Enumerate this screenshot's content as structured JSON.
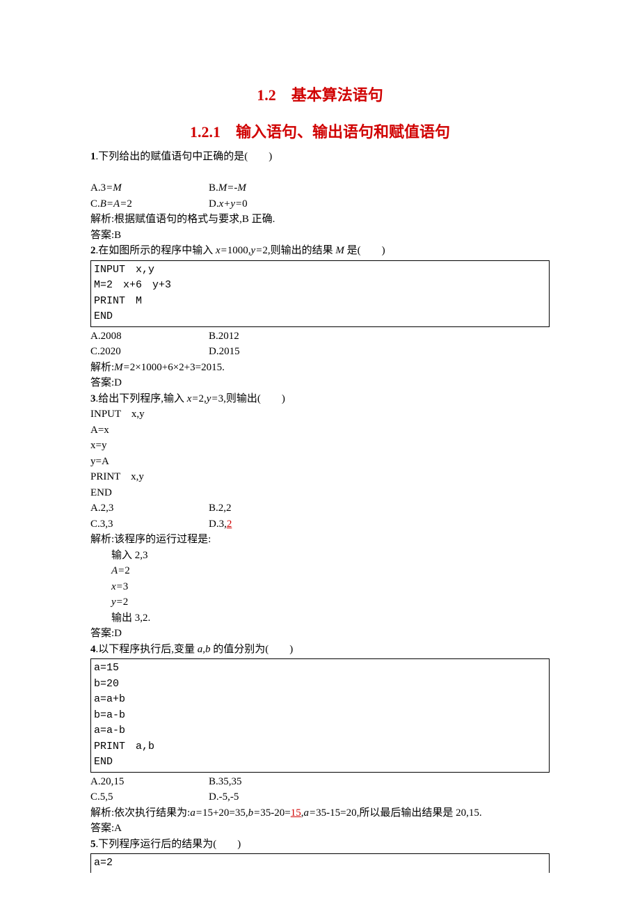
{
  "title_main": "1.2　基本算法语句",
  "title_sub": "1.2.1　输入语句、输出语句和赋值语句",
  "q1": {
    "stem_pre": "1",
    "stem": ".下列给出的赋值语句中正确的是(　　)",
    "a": "A.3=M",
    "b_full": "B.M=-M",
    "c_full": "C.B=A=2",
    "d_full": "D.x+y=0",
    "exp": "解析:根据赋值语句的格式与要求,B 正确.",
    "ans": "答案:B"
  },
  "q2": {
    "stem_pre": "2",
    "stem_a": ".在如图所示的程序中输入 ",
    "stem_x": "x=",
    "stem_xv": "1000,",
    "stem_y": "y=",
    "stem_yv": "2,则输出的结果 ",
    "stem_m": "M",
    "stem_end": " 是(　　)",
    "code": [
      "INPUT　x,y",
      "M=2　x+6　y+3",
      "PRINT　M",
      "END"
    ],
    "a": "A.2008",
    "b": "B.2012",
    "c": "C.2020",
    "d": "D.2015",
    "exp_pre": "解析:",
    "exp_m": "M=",
    "exp_rest": "2×1000+6×2+3=2015.",
    "ans": "答案:D"
  },
  "q3": {
    "stem_pre": "3",
    "stem_a": ".给出下列程序,输入 ",
    "stem_x": "x=",
    "stem_xv": "2,",
    "stem_y": "y=",
    "stem_yv": "3,则输出(　　)",
    "code": [
      "INPUT　x,y",
      "A=x",
      "x=y",
      "y=A",
      "PRINT　x,y",
      "END"
    ],
    "a": "A.2,3",
    "b": "B.2,2",
    "c": "C.3,3",
    "d_pre": "D.3,",
    "d_val": "2",
    "exp_head": "解析:该程序的运行过程是:",
    "step1": "输入 2,3",
    "step2_a": "A=",
    "step2_v": "2",
    "step3_a": "x=",
    "step3_v": "3",
    "step4_a": "y=",
    "step4_v": "2",
    "step5": "输出 3,2.",
    "ans": "答案:D"
  },
  "q4": {
    "stem_pre": "4",
    "stem_a": ".以下程序执行后,变量 ",
    "stem_ab": "a,b",
    "stem_end": " 的值分别为(　　)",
    "code": [
      "a=15",
      "b=20",
      "a=a+b",
      "b=a-b",
      "a=a-b",
      "PRINT　a,b",
      "END"
    ],
    "a": "A.20,15",
    "b": "B.35,35",
    "c": "C.5,5",
    "d": "D.-5,-5",
    "exp_pre": "解析:依次执行结果为:",
    "exp_a1": "a=",
    "exp_a1v": "15+20=35,",
    "exp_b1": "b=",
    "exp_b1v": "35-20=",
    "exp_b1_15": "15",
    "exp_b1_comma": ",",
    "exp_a2": "a=",
    "exp_a2v": "35-15=20,所以最后输出结果是 20,15.",
    "ans": "答案:A"
  },
  "q5": {
    "stem_pre": "5",
    "stem": ".下列程序运行后的结果为(　　)",
    "code": [
      "a=2"
    ]
  }
}
